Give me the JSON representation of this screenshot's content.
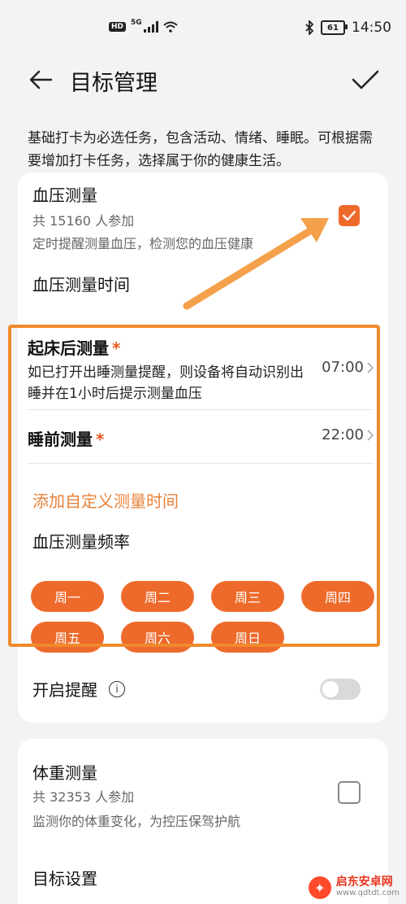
{
  "status_bar": {
    "hd": "HD",
    "network": "5G",
    "battery": "61",
    "time": "14:50"
  },
  "header": {
    "title": "目标管理"
  },
  "intro_text": "基础打卡为必选任务，包含活动、情绪、睡眠。可根据需要增加打卡任务，选择属于你的健康生活。",
  "blood_pressure": {
    "title": "血压测量",
    "participants": "共 15160 人参加",
    "description": "定时提醒测量血压，检测您的血压健康",
    "checked": true,
    "time_section_label": "血压测量时间",
    "after_wake": {
      "label": "起床后测量",
      "asterisk": "*",
      "description": "如已打开出睡测量提醒，则设备将自动识别出睡并在1小时后提示测量血压",
      "time": "07:00"
    },
    "before_sleep": {
      "label": "睡前测量",
      "asterisk": "*",
      "time": "22:00"
    },
    "add_custom_label": "添加自定义测量时间",
    "frequency_label": "血压测量频率",
    "days": [
      "周一",
      "周二",
      "周三",
      "周四",
      "周五",
      "周六",
      "周日"
    ],
    "reminder_label": "开启提醒",
    "reminder_on": false
  },
  "weight": {
    "title": "体重测量",
    "participants": "共 32353 人参加",
    "description": "监测你的体重变化，为控压保驾护航",
    "checked": false,
    "target_label": "目标设置"
  },
  "watermark": {
    "title": "启东安卓网",
    "url": "www.qdtdt.com"
  },
  "colors": {
    "accent": "#ee6a2b",
    "highlight": "#f08a2c",
    "link_orange": "#e8823a"
  }
}
